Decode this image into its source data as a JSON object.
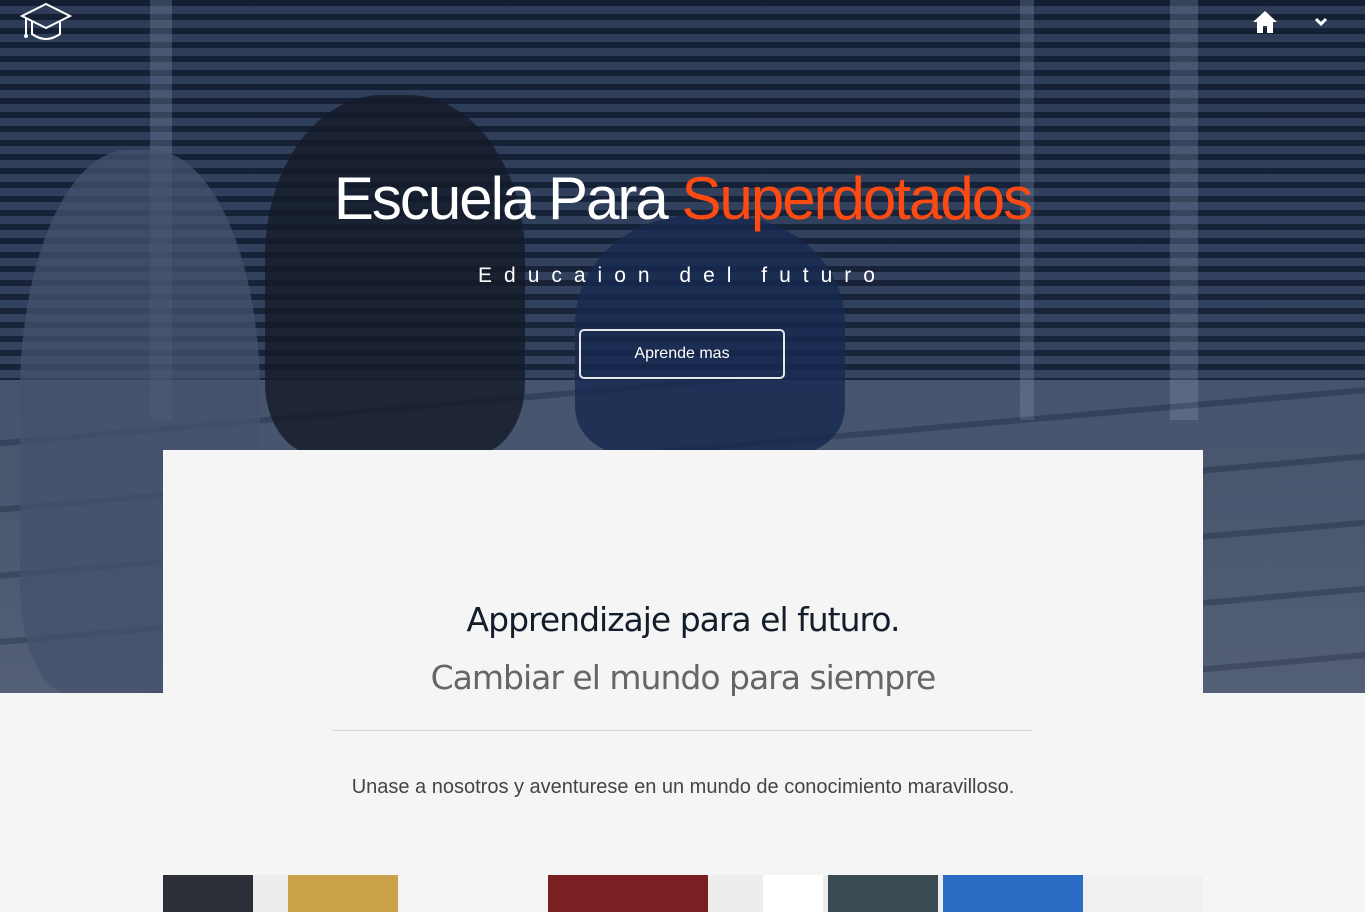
{
  "header": {
    "logo_icon": "graduation-cap-icon",
    "home_icon": "home-icon",
    "menu_icon": "chevron-down-icon"
  },
  "hero": {
    "title_main": "Escuela Para ",
    "title_accent": "Superdotados",
    "subtitle": "Educaion del futuro",
    "cta_label": "Aprende mas",
    "accent_color": "#ff4a12"
  },
  "intro": {
    "heading": "Apprendizaje para el futuro.",
    "subheading": "Cambiar el mundo para siempre",
    "text": "Unase a nosotros y aventurese en un mundo de conocimiento maravilloso."
  }
}
